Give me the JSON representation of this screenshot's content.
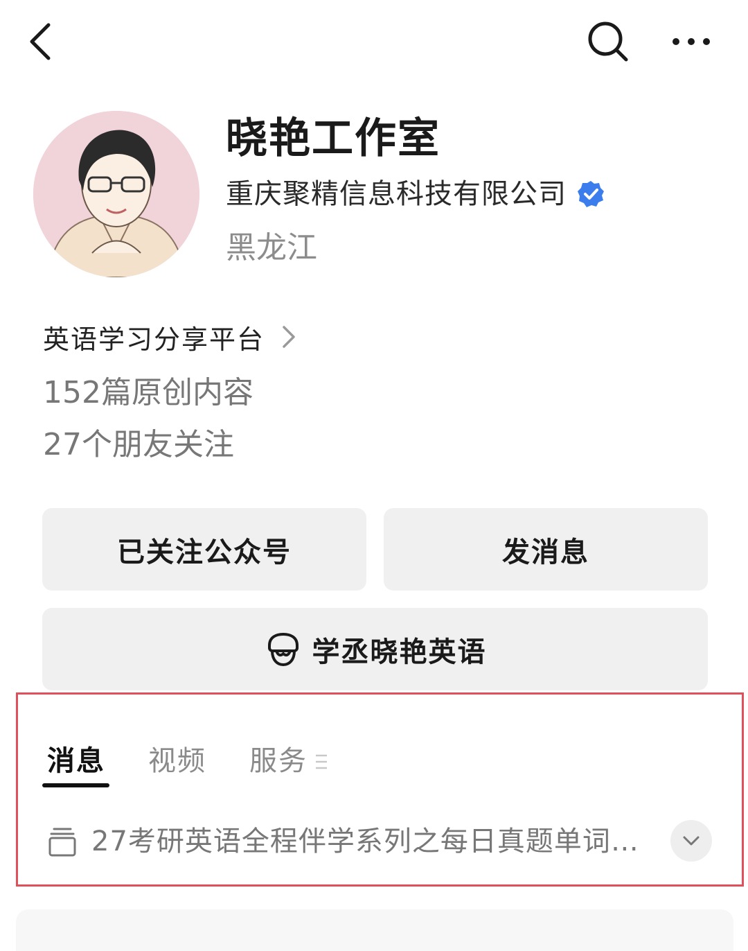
{
  "header": {
    "back_icon": "chevron-left-icon",
    "search_icon": "search-icon",
    "more_icon": "more-horizontal-icon"
  },
  "profile": {
    "name": "晓艳工作室",
    "company": "重庆聚精信息科技有限公司",
    "verified_icon": "verified-badge-icon",
    "region": "黑龙江",
    "intro": "英语学习分享平台",
    "original_count": "152篇原创内容",
    "friends_following": "27个朋友关注"
  },
  "actions": {
    "follow_label": "已关注公众号",
    "message_label": "发消息",
    "mini_program_label": "学丞晓艳英语",
    "mini_program_icon": "mini-program-logo-icon"
  },
  "tabs": [
    {
      "label": "消息",
      "active": true
    },
    {
      "label": "视频",
      "active": false
    },
    {
      "label": "服务",
      "active": false
    }
  ],
  "series": {
    "title": "27考研英语全程伴学系列之每日真题单词…",
    "icon": "collection-icon",
    "expand_icon": "chevron-down-icon"
  },
  "colors": {
    "highlight_border": "#e0505a",
    "verified_blue": "#3b7ded",
    "button_bg": "#f0f0f0"
  }
}
